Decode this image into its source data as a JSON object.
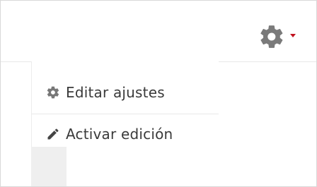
{
  "menu": {
    "items": [
      {
        "label": "Editar ajustes",
        "icon": "gear-icon"
      },
      {
        "label": "Activar edición",
        "icon": "pencil-icon"
      }
    ]
  },
  "settings_trigger": {
    "icon": "gear-icon",
    "caret": "caret-down-icon",
    "caret_color": "#c1121f"
  }
}
